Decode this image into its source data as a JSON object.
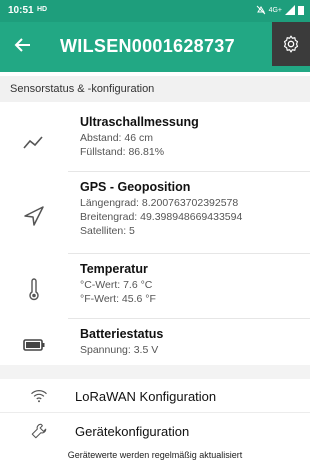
{
  "statusbar": {
    "time": "10:51",
    "hd": "HD",
    "network": "4G+"
  },
  "appbar": {
    "title": "WILSEN0001628737"
  },
  "section": {
    "title": "Sensorstatus & -konfiguration"
  },
  "items": [
    {
      "title": "Ultraschallmessung",
      "lines": [
        "Abstand: 46 cm",
        "Füllstand: 86.81%"
      ],
      "icon": "trend-line-icon"
    },
    {
      "title": "GPS - Geoposition",
      "lines": [
        "Längengrad: 8.200763702392578",
        "Breitengrad: 49.398948669433594",
        "Satelliten: 5"
      ],
      "icon": "navigation-arrow-icon"
    },
    {
      "title": "Temperatur",
      "lines": [
        "°C-Wert: 7.6 °C",
        "°F-Wert: 45.6 °F"
      ],
      "icon": "thermometer-icon"
    },
    {
      "title": "Batteriestatus",
      "lines": [
        "Spannung: 3.5 V"
      ],
      "icon": "battery-icon"
    }
  ],
  "menu": [
    {
      "label": "LoRaWAN Konfiguration",
      "icon": "wifi-icon"
    },
    {
      "label": "Gerätekonfiguration",
      "icon": "wrench-icon"
    }
  ],
  "footer": {
    "text": "Gerätewerte werden regelmäßig aktualisiert"
  },
  "colors": {
    "primary": "#22a884",
    "statusbar": "#1e9e7c",
    "settings_bg": "#3b3b3b"
  }
}
